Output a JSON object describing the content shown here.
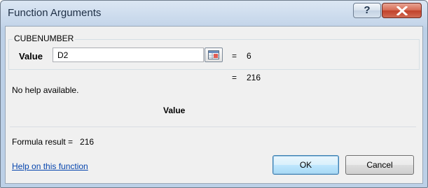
{
  "window": {
    "title": "Function Arguments",
    "help_glyph": "?",
    "close_glyph": "×"
  },
  "function": {
    "name": "CUBENUMBER",
    "argument": {
      "label": "Value",
      "value": "D2",
      "evaluated": "6"
    },
    "result_preview": "216",
    "help_text": "No help available.",
    "argument_description": "Value"
  },
  "formula_result": {
    "label": "Formula result =",
    "value": "216"
  },
  "footer": {
    "help_link": "Help on this function",
    "ok_label": "OK",
    "cancel_label": "Cancel"
  },
  "equals_sign": "=",
  "icons": {
    "ref_button": "collapse-dialog-icon",
    "close": "close-icon",
    "help": "help-icon"
  },
  "colors": {
    "title_bar": "#c5d6ea",
    "close_button": "#c1412a",
    "link": "#0645ad",
    "dialog_background": "#f0f0f0"
  }
}
